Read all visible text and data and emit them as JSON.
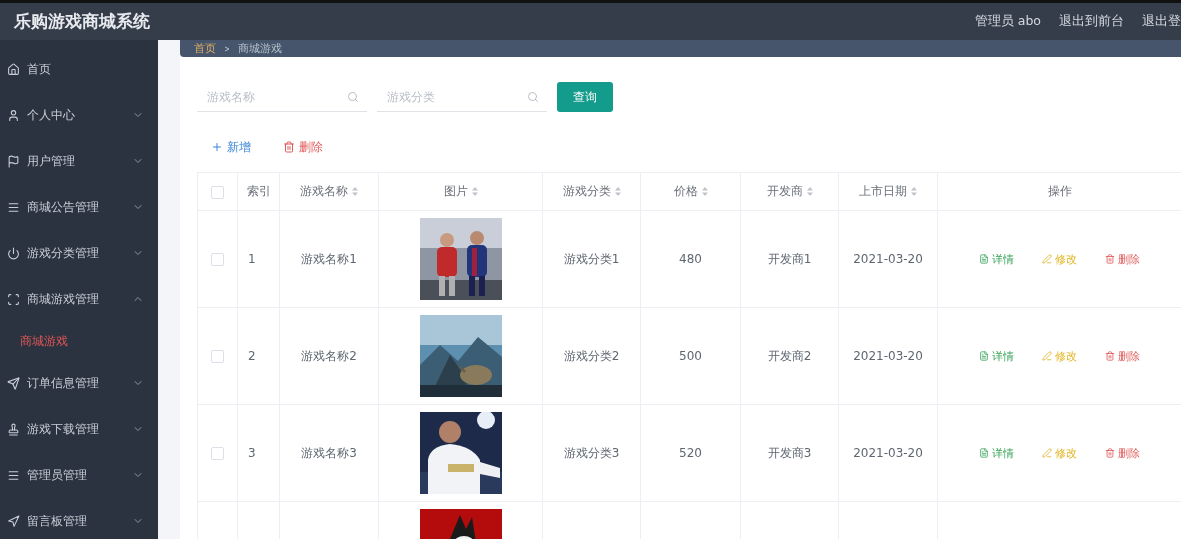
{
  "header": {
    "title": "乐购游戏商城系统",
    "links": [
      "管理员 abo",
      "退出到前台",
      "退出登"
    ]
  },
  "sidebar": {
    "items": [
      {
        "label": "首页",
        "has_children": false
      },
      {
        "label": "个人中心",
        "has_children": true,
        "expanded": false
      },
      {
        "label": "用户管理",
        "has_children": true,
        "expanded": false
      },
      {
        "label": "商城公告管理",
        "has_children": true,
        "expanded": false
      },
      {
        "label": "游戏分类管理",
        "has_children": true,
        "expanded": false
      },
      {
        "label": "商城游戏管理",
        "has_children": true,
        "expanded": true,
        "children": [
          {
            "label": "商城游戏",
            "selected": true
          }
        ]
      },
      {
        "label": "订单信息管理",
        "has_children": true,
        "expanded": false
      },
      {
        "label": "游戏下载管理",
        "has_children": true,
        "expanded": false
      },
      {
        "label": "管理员管理",
        "has_children": true,
        "expanded": false
      },
      {
        "label": "留言板管理",
        "has_children": true,
        "expanded": false
      }
    ]
  },
  "breadcrumb": [
    "首页",
    "商城游戏"
  ],
  "search": {
    "fields": [
      {
        "placeholder": "游戏名称"
      },
      {
        "placeholder": "游戏分类"
      }
    ],
    "button": "查询"
  },
  "toolbar": [
    {
      "label": "新增",
      "kind": "add"
    },
    {
      "label": "删除",
      "kind": "delete"
    }
  ],
  "table": {
    "columns": [
      {
        "kind": "checkbox",
        "checked": false
      },
      {
        "label": "索引",
        "sortable": false
      },
      {
        "label": "游戏名称",
        "sortable": true
      },
      {
        "label": "图片",
        "sortable": true
      },
      {
        "label": "游戏分类",
        "sortable": true
      },
      {
        "label": "价格",
        "sortable": true
      },
      {
        "label": "开发商",
        "sortable": true
      },
      {
        "label": "上市日期",
        "sortable": true
      },
      {
        "label": "操作",
        "sortable": false
      }
    ],
    "rows": [
      {
        "checked": false,
        "index": "1",
        "name": "游戏名称1",
        "picture": {
          "kind": "picture"
        },
        "category": "游戏分类1",
        "price": "480",
        "developer": "开发商1",
        "date": "2021-03-20",
        "actions": [
          {
            "label": "详情",
            "kind": "detail"
          },
          {
            "label": "修改",
            "kind": "edit"
          },
          {
            "label": "删除",
            "kind": "delete"
          }
        ]
      },
      {
        "checked": false,
        "index": "2",
        "name": "游戏名称2",
        "picture": {
          "kind": "picture"
        },
        "category": "游戏分类2",
        "price": "500",
        "developer": "开发商2",
        "date": "2021-03-20",
        "actions": [
          {
            "label": "详情",
            "kind": "detail"
          },
          {
            "label": "修改",
            "kind": "edit"
          },
          {
            "label": "删除",
            "kind": "delete"
          }
        ]
      },
      {
        "checked": false,
        "index": "3",
        "name": "游戏名称3",
        "picture": {
          "kind": "picture"
        },
        "category": "游戏分类3",
        "price": "520",
        "developer": "开发商3",
        "date": "2021-03-20",
        "actions": [
          {
            "label": "详情",
            "kind": "detail"
          },
          {
            "label": "修改",
            "kind": "edit"
          },
          {
            "label": "删除",
            "kind": "delete"
          }
        ]
      },
      {
        "picture": {
          "kind": "picture"
        }
      }
    ]
  }
}
